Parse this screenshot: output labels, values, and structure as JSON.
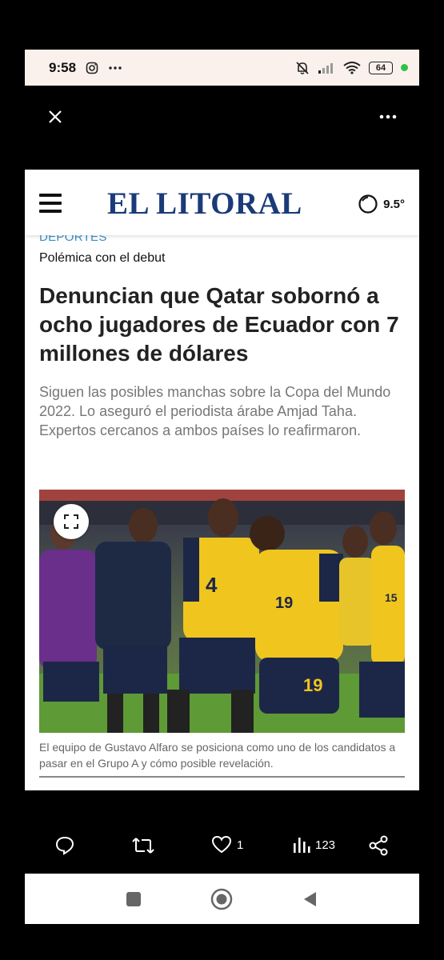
{
  "status": {
    "time": "9:58",
    "battery": "64"
  },
  "site": {
    "logo": "EL LITORAL",
    "temperature": "9.5°"
  },
  "article": {
    "section": "DEPORTES",
    "kicker": "Polémica con el debut",
    "headline": "Denuncian que Qatar sobornó a ocho jugadores de Ecuador con 7 millones de dólares",
    "summary": "Siguen las posibles manchas sobre la Copa del Mundo 2022. Lo aseguró el periodista árabe Amjad Taha. Expertos cercanos a ambos países lo reafirmaron.",
    "photo_jersey_numbers": [
      "4",
      "19",
      "19",
      "15"
    ],
    "caption": "El equipo de Gustavo Alfaro se posiciona como uno de los candidatos a pasar en el Grupo A y cómo posible revelación."
  },
  "actions": {
    "likes": "1",
    "views": "123"
  },
  "colors": {
    "logo": "#1a3b78",
    "section": "#3a8ec8",
    "status_bg": "#fbf1ec",
    "jersey_yellow": "#f0c51e",
    "jersey_navy": "#1c2748"
  }
}
